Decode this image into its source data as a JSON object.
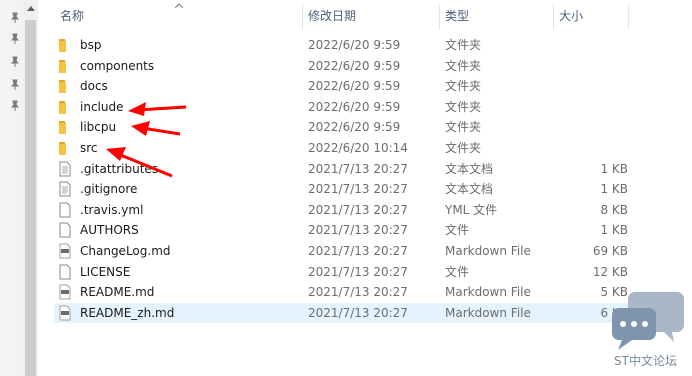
{
  "columns": {
    "name": "名称",
    "date": "修改日期",
    "type": "类型",
    "size": "大小"
  },
  "files": [
    {
      "name": "bsp",
      "date": "2022/6/20 9:59",
      "type": "文件夹",
      "size": "",
      "icon": "folder-icon"
    },
    {
      "name": "components",
      "date": "2022/6/20 9:59",
      "type": "文件夹",
      "size": "",
      "icon": "folder-icon"
    },
    {
      "name": "docs",
      "date": "2022/6/20 9:59",
      "type": "文件夹",
      "size": "",
      "icon": "folder-icon"
    },
    {
      "name": "include",
      "date": "2022/6/20 9:59",
      "type": "文件夹",
      "size": "",
      "icon": "folder-icon"
    },
    {
      "name": "libcpu",
      "date": "2022/6/20 9:59",
      "type": "文件夹",
      "size": "",
      "icon": "folder-icon"
    },
    {
      "name": "src",
      "date": "2022/6/20 10:14",
      "type": "文件夹",
      "size": "",
      "icon": "folder-icon"
    },
    {
      "name": ".gitattributes",
      "date": "2021/7/13 20:27",
      "type": "文本文档",
      "size": "1 KB",
      "icon": "text-document-icon"
    },
    {
      "name": ".gitignore",
      "date": "2021/7/13 20:27",
      "type": "文本文档",
      "size": "1 KB",
      "icon": "text-document-icon"
    },
    {
      "name": ".travis.yml",
      "date": "2021/7/13 20:27",
      "type": "YML 文件",
      "size": "8 KB",
      "icon": "blank-file-icon"
    },
    {
      "name": "AUTHORS",
      "date": "2021/7/13 20:27",
      "type": "文件",
      "size": "1 KB",
      "icon": "blank-file-icon"
    },
    {
      "name": "ChangeLog.md",
      "date": "2021/7/13 20:27",
      "type": "Markdown File",
      "size": "69 KB",
      "icon": "markdown-file-icon"
    },
    {
      "name": "LICENSE",
      "date": "2021/7/13 20:27",
      "type": "文件",
      "size": "12 KB",
      "icon": "blank-file-icon"
    },
    {
      "name": "README.md",
      "date": "2021/7/13 20:27",
      "type": "Markdown File",
      "size": "5 KB",
      "icon": "markdown-file-icon"
    },
    {
      "name": "README_zh.md",
      "date": "2021/7/13 20:27",
      "type": "Markdown File",
      "size": "6 KB",
      "icon": "markdown-file-icon",
      "selected": true
    }
  ],
  "annotations": {
    "arrow_color": "#ff0000",
    "arrow_targets": [
      "include",
      "libcpu",
      "src"
    ]
  },
  "watermark": {
    "text": "ST中文论坛"
  },
  "colors": {
    "folder": "#f5c242",
    "selected_row": "#e5f3ff",
    "header_text": "#4c607a"
  }
}
